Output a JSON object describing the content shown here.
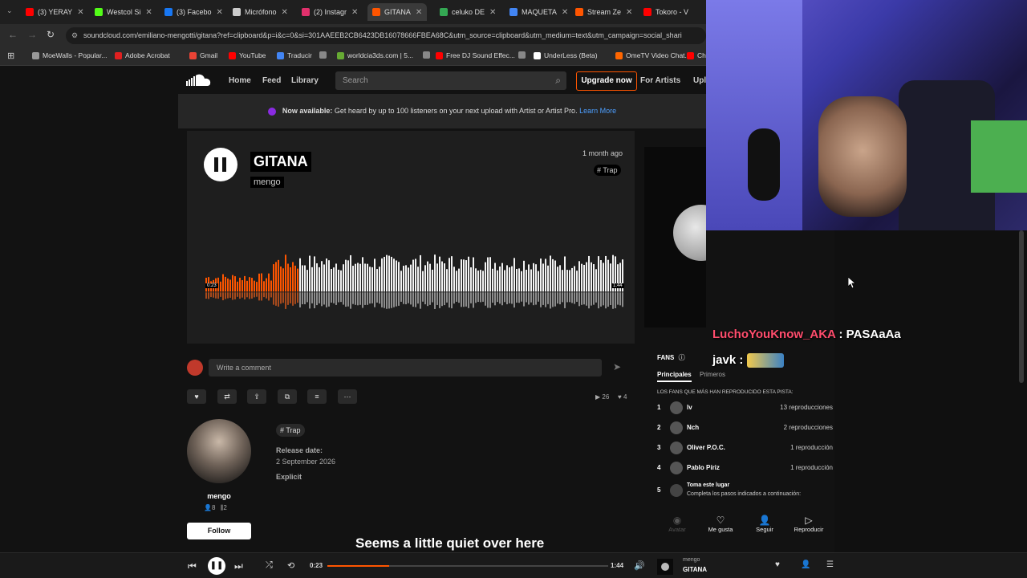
{
  "browser": {
    "tabs": [
      {
        "label": "(3) YERAY",
        "color": "#ff0000"
      },
      {
        "label": "Westcol Si",
        "color": "#53fc18"
      },
      {
        "label": "(3) Facebo",
        "color": "#1877f2"
      },
      {
        "label": "Micrófono",
        "color": "#cccccc"
      },
      {
        "label": "(2) Instagr",
        "color": "#e1306c"
      },
      {
        "label": "GITANA",
        "color": "#ff5500"
      },
      {
        "label": "celuko DE",
        "color": "#34a853"
      },
      {
        "label": "MAQUETA",
        "color": "#4285f4"
      },
      {
        "label": "Stream Ze",
        "color": "#ff5500"
      },
      {
        "label": "Tokoro - V",
        "color": "#ff0000"
      }
    ],
    "url": "soundcloud.com/emiliano-mengotti/gitana?ref=clipboard&p=i&c=0&si=301AAEEB2CB6423DB16078666FBEA68C&utm_source=clipboard&utm_medium=text&utm_campaign=social_shari",
    "bookmarks": [
      {
        "label": "MoeWalls - Popular...",
        "color": "#999999"
      },
      {
        "label": "Adobe Acrobat",
        "color": "#e02020"
      },
      {
        "label": "Gmail",
        "color": "#ea4335"
      },
      {
        "label": "YouTube",
        "color": "#ff0000"
      },
      {
        "label": "Traducir",
        "color": "#4285f4"
      },
      {
        "label": "",
        "color": "#888888"
      },
      {
        "label": "worldcia3ds.com | 5...",
        "color": "#66aa33"
      },
      {
        "label": "",
        "color": "#888888"
      },
      {
        "label": "Free DJ Sound Effec...",
        "color": "#ff0000"
      },
      {
        "label": "",
        "color": "#888888"
      },
      {
        "label": "UnderLess (Beta)",
        "color": "#ffffff"
      },
      {
        "label": "OmeTV Video Chat...",
        "color": "#ff6600"
      },
      {
        "label": "Ch",
        "color": "#ff0000"
      }
    ]
  },
  "header": {
    "nav": [
      "Home",
      "Feed",
      "Library"
    ],
    "search_placeholder": "Search",
    "upgrade": "Upgrade now",
    "for_artists": "For Artists",
    "upload": "Upl"
  },
  "banner": {
    "bold": "Now available:",
    "text": " Get heard by up to 100 listeners on your next upload with Artist or Artist Pro. ",
    "link": "Learn More"
  },
  "track": {
    "title": "GITANA",
    "artist": "mengo",
    "age": "1 month ago",
    "tag": "# Trap",
    "time_start": "0:23",
    "time_end": "1:44",
    "progress": 0.22
  },
  "comment": {
    "placeholder": "Write a comment"
  },
  "stats": {
    "plays": "26",
    "likes": "4"
  },
  "artist_block": {
    "name": "mengo",
    "followers": "8",
    "tracks": "2",
    "follow": "Follow",
    "tag": "# Trap",
    "release_label": "Release date:",
    "release_date": "2 September 2026",
    "explicit": "Explicit"
  },
  "fans": {
    "title": "FANS",
    "tabs": [
      "Principales",
      "Primeros"
    ],
    "subtitle": "LOS FANS QUE MÁS HAN REPRODUCIDO ESTA PISTA:",
    "rows": [
      {
        "n": "1",
        "name": "lv",
        "count": "13 reproducciones"
      },
      {
        "n": "2",
        "name": "Nch",
        "count": "2 reproducciones"
      },
      {
        "n": "3",
        "name": "Oliver P.O.C.",
        "count": "1 reproducción"
      },
      {
        "n": "4",
        "name": "Pablo Píriz",
        "count": "1 reproducción"
      }
    ],
    "slot": {
      "n": "5",
      "title": "Toma este lugar",
      "text": "Completa los pasos indicados a continuación:"
    },
    "actions": [
      "Avatar",
      "Me gusta",
      "Seguir",
      "Reproducir"
    ]
  },
  "empty_message": "Seems a little quiet over here",
  "player": {
    "current": "0:23",
    "total": "1:44",
    "progress": 0.22,
    "artist": "mengo",
    "title": "GITANA"
  },
  "chat": [
    {
      "user": "LuchoYouKnow_AKA",
      "msg": "PASAaAa",
      "color": "#ff4d6d"
    },
    {
      "user": "javk",
      "msg": "",
      "color": "#ffffff"
    }
  ]
}
